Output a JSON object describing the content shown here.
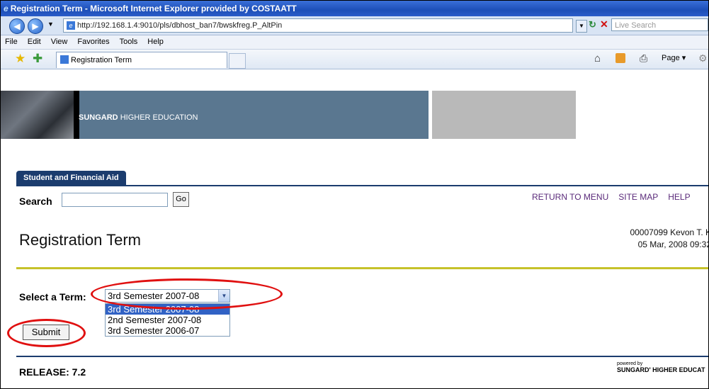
{
  "window": {
    "title": "Registration Term - Microsoft Internet Explorer provided by COSTAATT"
  },
  "address": {
    "url": "http://192.168.1.4:9010/pls/dbhost_ban7/bwskfreg.P_AltPin",
    "search_placeholder": "Live Search"
  },
  "menu": [
    "File",
    "Edit",
    "View",
    "Favorites",
    "Tools",
    "Help"
  ],
  "tabs": {
    "active_label": "Registration Term",
    "page_button": "Page ▾"
  },
  "banner": {
    "brand": "SUNGARD",
    "tagline": "HIGHER EDUCATION"
  },
  "nav": {
    "tab_label": "Student and Financial Aid"
  },
  "search": {
    "label": "Search",
    "go_label": "Go"
  },
  "top_links": [
    "RETURN TO MENU",
    "SITE MAP",
    "HELP"
  ],
  "page": {
    "title": "Registration Term"
  },
  "user": {
    "line1": "00007099 Kevon T. K",
    "line2": "05 Mar, 2008 09:32"
  },
  "term": {
    "label": "Select a Term:",
    "selected": "3rd Semester 2007-08",
    "options": [
      "3rd Semester 2007-08",
      "2nd Semester 2007-08",
      "3rd Semester 2006-07"
    ]
  },
  "submit": {
    "label": "Submit"
  },
  "footer": {
    "release": "RELEASE: 7.2",
    "powered_by": "powered by",
    "powered_brand": "SUNGARD' HIGHER EDUCAT"
  }
}
